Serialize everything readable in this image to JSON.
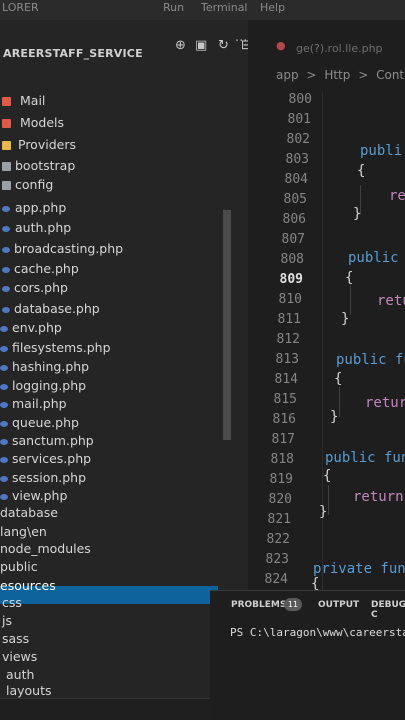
{
  "menu": {
    "explorer": "LORER",
    "run": "Run",
    "terminal": "Terminal",
    "help": "Help"
  },
  "explorer": {
    "project": "AREERSTAFF_SERVICE",
    "more": "...",
    "toolbar_icons": [
      "new-file-icon",
      "new-folder-icon",
      "refresh-icon",
      "collapse-all-icon"
    ],
    "items": [
      {
        "label": "Mail",
        "icon": "folder-red"
      },
      {
        "label": "Models",
        "icon": "folder-red"
      },
      {
        "label": "Providers",
        "icon": "folder-yellow"
      },
      {
        "label": "bootstrap",
        "icon": "folder-grey"
      },
      {
        "label": "config",
        "icon": "folder-grey"
      },
      {
        "label": "app.php",
        "icon": "php"
      },
      {
        "label": "auth.php",
        "icon": "php"
      },
      {
        "label": "broadcasting.php",
        "icon": "php"
      },
      {
        "label": "cache.php",
        "icon": "php"
      },
      {
        "label": "cors.php",
        "icon": "php"
      },
      {
        "label": "database.php",
        "icon": "php"
      },
      {
        "label": "env.php",
        "icon": "php"
      },
      {
        "label": "filesystems.php",
        "icon": "php"
      },
      {
        "label": "hashing.php",
        "icon": "php"
      },
      {
        "label": "logging.php",
        "icon": "php"
      },
      {
        "label": "mail.php",
        "icon": "php"
      },
      {
        "label": "queue.php",
        "icon": "php"
      },
      {
        "label": "sanctum.php",
        "icon": "php"
      },
      {
        "label": "services.php",
        "icon": "php"
      },
      {
        "label": "session.php",
        "icon": "php"
      },
      {
        "label": "view.php",
        "icon": "php"
      },
      {
        "label": "database",
        "icon": "none"
      },
      {
        "label": "lang\\en",
        "icon": "none"
      },
      {
        "label": "node_modules",
        "icon": "none"
      },
      {
        "label": "public",
        "icon": "none"
      },
      {
        "label": "esources",
        "icon": "none"
      },
      {
        "label": "css",
        "icon": "none"
      },
      {
        "label": "js",
        "icon": "none"
      },
      {
        "label": "sass",
        "icon": "none"
      },
      {
        "label": "views",
        "icon": "none"
      },
      {
        "label": "auth",
        "icon": "none"
      },
      {
        "label": "layouts",
        "icon": "none"
      }
    ]
  },
  "editor": {
    "tab_label": "ge(?).rol.lle.php",
    "breadcrumb": [
      "app",
      ">",
      "Http",
      ">",
      "Controller"
    ],
    "line_numbers": [
      "800",
      "801",
      "802",
      "803",
      "804",
      "805",
      "806",
      "807",
      "808",
      "809",
      "810",
      "811",
      "812",
      "813",
      "814",
      "815",
      "816",
      "817",
      "818",
      "819",
      "820",
      "821",
      "822",
      "823",
      "824"
    ],
    "current_line": "809",
    "code": {
      "l802": "publi",
      "l803": "{",
      "l804": "re",
      "l805": "}",
      "l808": "public",
      "l809": "{",
      "l810": "retu",
      "l811": "}",
      "l813": "public fu",
      "l814": "{",
      "l815": "retur",
      "l816": "}",
      "l818": "public fun",
      "l819": "{",
      "l820": "return",
      "l821": "}",
      "l823": "private func",
      "l824": "{"
    }
  },
  "panel": {
    "problems": "PROBLEMS",
    "problems_count": "11",
    "output": "OUTPUT",
    "debug": "DEBUG C",
    "terminal_line": "PS C:\\laragon\\www\\careerstaff_"
  },
  "colors": {
    "selection": "#0e639c",
    "keyword": "#569cd6",
    "return_keyword": "#c586c0"
  }
}
